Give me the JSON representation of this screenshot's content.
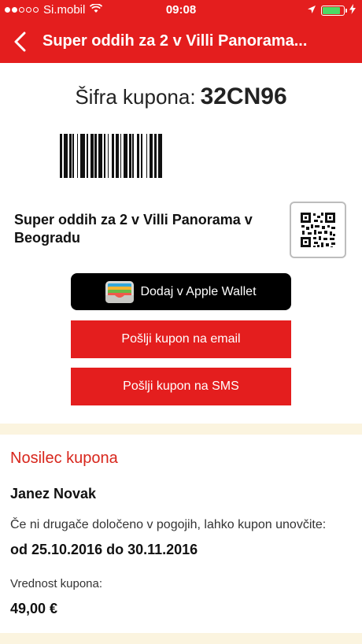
{
  "status_bar": {
    "carrier": "Si.mobil",
    "time": "09:08",
    "signal_bars_filled": 2,
    "signal_bars_total": 5,
    "battery_level": 0.9,
    "icons": [
      "wifi-icon",
      "location-arrow-icon",
      "battery-icon",
      "charging-bolt-icon"
    ]
  },
  "nav": {
    "title": "Super oddih za 2 v Villi Panorama...",
    "back_icon": "chevron-left-icon"
  },
  "coupon": {
    "code_label": "Šifra kupona:",
    "code": "32CN96",
    "barcode_icon": "barcode-icon",
    "offer_title": "Super oddih za 2 v Villi Panorama v Beogradu",
    "qr_icon": "qr-code-icon"
  },
  "actions": {
    "wallet_label": "Dodaj v Apple Wallet",
    "email_label": "Pošlji kupon na email",
    "sms_label": "Pošlji kupon na SMS"
  },
  "holder": {
    "heading": "Nosilec kupona",
    "name": "Janez Novak",
    "validity_note": "Če ni drugače določeno v pogojih, lahko kupon unovčite:",
    "validity_range": "od 25.10.2016 do 30.11.2016",
    "value_label": "Vrednost kupona:",
    "value": "49,00 €"
  },
  "colors": {
    "brand_red": "#e41e1e",
    "heading_red": "#d8261c",
    "divider_cream": "#fbf4df",
    "battery_green": "#4cd964"
  }
}
